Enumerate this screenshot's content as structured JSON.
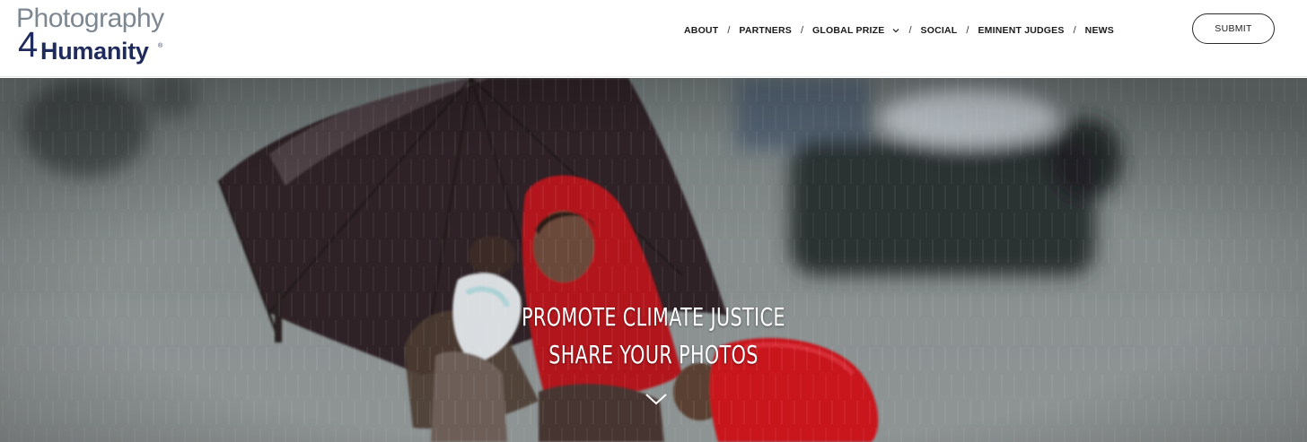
{
  "brand": {
    "logo_top": "Photography",
    "logo_four": "4",
    "logo_bottom": "Humanity",
    "logo_tm": "®"
  },
  "nav": {
    "items": [
      "ABOUT",
      "PARTNERS",
      "GLOBAL PRIZE",
      "SOCIAL",
      "EMINENT JUDGES",
      "NEWS"
    ],
    "separator": "/"
  },
  "header": {
    "submit_label": "SUBMIT"
  },
  "hero": {
    "line1": "PROMOTE CLIMATE JUSTICE",
    "line2": "SHARE YOUR PHOTOS"
  },
  "colors": {
    "brand_navy": "#1f2b5c",
    "logo_gray": "#7d8790",
    "hero_overlay": "#7e8686",
    "umbrella": "#2e2226",
    "red_garment": "#c0121e"
  },
  "icons": {
    "dropdown": "chevron-down-icon",
    "scroll": "chevron-down-icon"
  }
}
